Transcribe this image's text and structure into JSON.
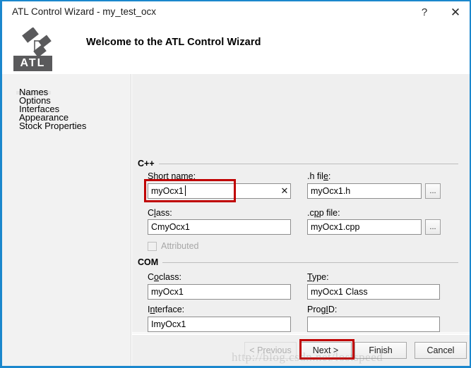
{
  "window": {
    "title": "ATL Control Wizard - my_test_ocx",
    "help_button": "?",
    "close_button": "✕",
    "accent_color": "#1b87cd"
  },
  "banner": {
    "heading": "Welcome to the ATL Control Wizard",
    "logo_text": "ATL",
    "logo_icon": "atl-nodes-icon"
  },
  "sidebar": {
    "items": [
      {
        "label": "Names",
        "selected": true
      },
      {
        "label": "Options",
        "selected": false
      },
      {
        "label": "Interfaces",
        "selected": false
      },
      {
        "label": "Appearance",
        "selected": false
      },
      {
        "label": "Stock Properties",
        "selected": false
      }
    ]
  },
  "groups": {
    "cpp": {
      "label": "C++",
      "short_name": {
        "label": "Short name:",
        "accel": "n",
        "value": "myOcx1",
        "placeholder": "",
        "clear_icon": "✕",
        "focused": true,
        "highlight_color": "#c00000"
      },
      "class": {
        "label": "Class:",
        "accel": "l",
        "value": "CmyOcx1",
        "placeholder": ""
      },
      "h_file": {
        "label": ".h file:",
        "accel": "e",
        "value": "myOcx1.h",
        "placeholder": "",
        "browse_label": "..."
      },
      "cpp_file": {
        "label": ".cpp file:",
        "accel": "p",
        "value": "myOcx1.cpp",
        "placeholder": "",
        "browse_label": "..."
      },
      "attributed": {
        "label": "Attributed",
        "checked": false,
        "disabled": true
      }
    },
    "com": {
      "label": "COM",
      "coclass": {
        "label": "Coclass:",
        "accel": "o",
        "value": "myOcx1",
        "placeholder": ""
      },
      "interface": {
        "label": "Interface:",
        "accel": "n",
        "value": "ImyOcx1",
        "placeholder": ""
      },
      "type": {
        "label": "Type:",
        "accel": "T",
        "value": "myOcx1 Class",
        "placeholder": ""
      },
      "progid": {
        "label": "ProgID:",
        "accel": "D",
        "value": "",
        "placeholder": ""
      }
    }
  },
  "footer": {
    "previous": "< Previous",
    "next": "Next >",
    "finish": "Finish",
    "cancel": "Cancel",
    "previous_disabled": true,
    "next_highlighted": true,
    "highlight_color": "#c00000"
  },
  "watermark": {
    "text": "http://blog.csdn.net/lostspeed"
  }
}
